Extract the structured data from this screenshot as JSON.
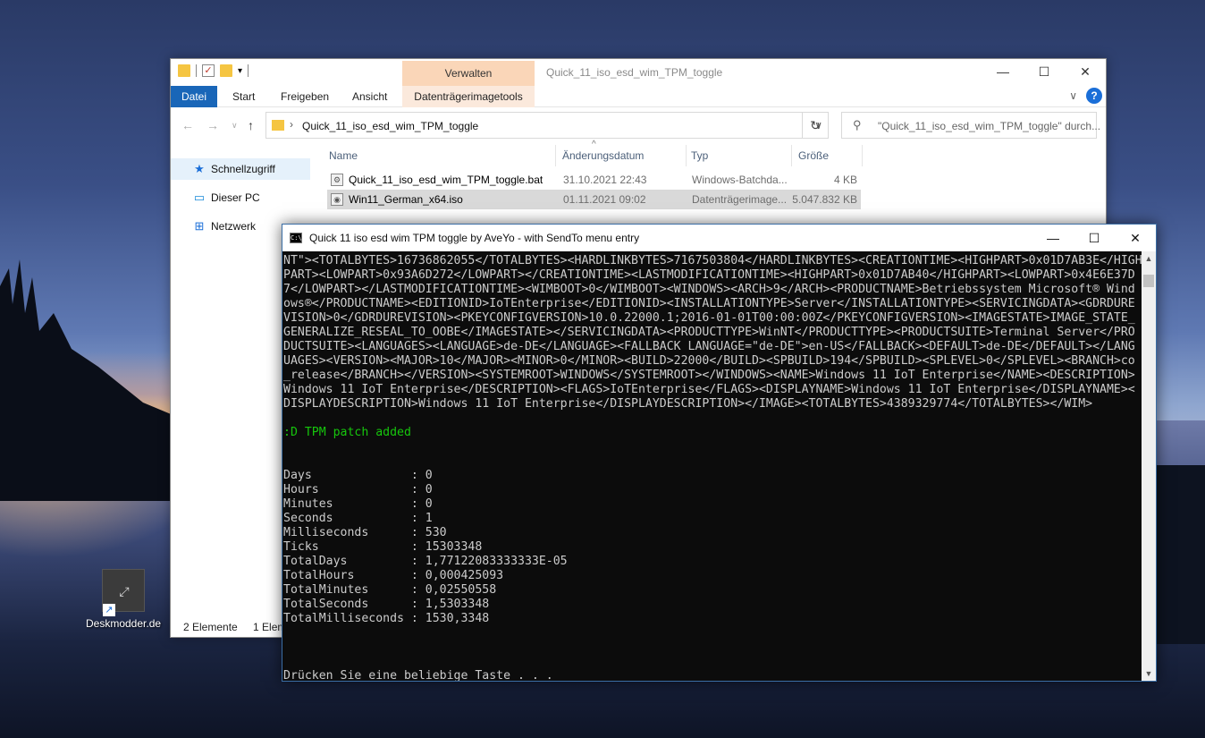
{
  "desktop": {
    "icon_label": "Deskmodder.de"
  },
  "explorer": {
    "contextual_tab_header": "Verwalten",
    "window_title": "Quick_11_iso_esd_wim_TPM_toggle",
    "tabs": [
      "Datei",
      "Start",
      "Freigeben",
      "Ansicht",
      "Datenträgerimagetools"
    ],
    "address_path": "Quick_11_iso_esd_wim_TPM_toggle",
    "search_placeholder": "\"Quick_11_iso_esd_wim_TPM_toggle\" durch...",
    "nav_items": [
      "Schnellzugriff",
      "Dieser PC",
      "Netzwerk"
    ],
    "columns": [
      "Name",
      "Änderungsdatum",
      "Typ",
      "Größe"
    ],
    "files": [
      {
        "name": "Quick_11_iso_esd_wim_TPM_toggle.bat",
        "date": "31.10.2021 22:43",
        "type": "Windows-Batchda...",
        "size": "4 KB"
      },
      {
        "name": "Win11_German_x64.iso",
        "date": "01.11.2021 09:02",
        "type": "Datenträgerimage...",
        "size": "5.047.832 KB"
      }
    ],
    "status": {
      "count": "2 Elemente",
      "selected": "1 Elem"
    }
  },
  "console": {
    "title": "Quick 11 iso esd wim TPM toggle by AveYo - with SendTo menu entry",
    "lines": [
      "NT\"><TOTALBYTES>16736862055</TOTALBYTES><HARDLINKBYTES>7167503804</HARDLINKBYTES><CREATIONTIME><HIGHPART>0x01D7AB3E</HIGH",
      "PART><LOWPART>0x93A6D272</LOWPART></CREATIONTIME><LASTMODIFICATIONTIME><HIGHPART>0x01D7AB40</HIGHPART><LOWPART>0x4E6E37D",
      "7</LOWPART></LASTMODIFICATIONTIME><WIMBOOT>0</WIMBOOT><WINDOWS><ARCH>9</ARCH><PRODUCTNAME>Betriebssystem Microsoft® Wind",
      "ows®</PRODUCTNAME><EDITIONID>IoTEnterprise</EDITIONID><INSTALLATIONTYPE>Server</INSTALLATIONTYPE><SERVICINGDATA><GDRDURE",
      "VISION>0</GDRDUREVISION><PKEYCONFIGVERSION>10.0.22000.1;2016-01-01T00:00:00Z</PKEYCONFIGVERSION><IMAGESTATE>IMAGE_STATE_",
      "GENERALIZE_RESEAL_TO_OOBE</IMAGESTATE></SERVICINGDATA><PRODUCTTYPE>WinNT</PRODUCTTYPE><PRODUCTSUITE>Terminal Server</PRO",
      "DUCTSUITE><LANGUAGES><LANGUAGE>de-DE</LANGUAGE><FALLBACK LANGUAGE=\"de-DE\">en-US</FALLBACK><DEFAULT>de-DE</DEFAULT></LANG",
      "UAGES><VERSION><MAJOR>10</MAJOR><MINOR>0</MINOR><BUILD>22000</BUILD><SPBUILD>194</SPBUILD><SPLEVEL>0</SPLEVEL><BRANCH>co",
      "_release</BRANCH></VERSION><SYSTEMROOT>WINDOWS</SYSTEMROOT></WINDOWS><NAME>Windows 11 IoT Enterprise</NAME><DESCRIPTION>",
      "Windows 11 IoT Enterprise</DESCRIPTION><FLAGS>IoTEnterprise</FLAGS><DISPLAYNAME>Windows 11 IoT Enterprise</DISPLAYNAME><",
      "DISPLAYDESCRIPTION>Windows 11 IoT Enterprise</DISPLAYDESCRIPTION></IMAGE><TOTALBYTES>4389329774</TOTALBYTES></WIM>",
      "",
      ":D TPM patch added",
      "",
      "",
      "Days              : 0",
      "Hours             : 0",
      "Minutes           : 0",
      "Seconds           : 1",
      "Milliseconds      : 530",
      "Ticks             : 15303348",
      "TotalDays         : 1,77122083333333E-05",
      "TotalHours        : 0,000425093",
      "TotalMinutes      : 0,02550558",
      "TotalSeconds      : 1,5303348",
      "TotalMilliseconds : 1530,3348",
      "",
      "",
      "",
      "Drücken Sie eine beliebige Taste . . ."
    ],
    "green_line_index": 12
  }
}
